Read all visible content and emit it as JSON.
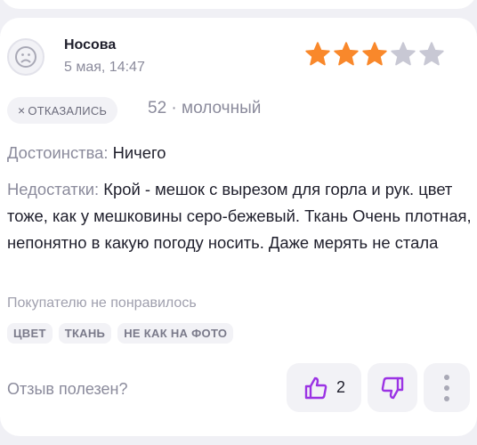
{
  "review": {
    "author": "Носова",
    "date": "5 мая, 14:47",
    "rating": 3,
    "max_rating": 5,
    "status_chip": "ОТКАЗАЛИСЬ",
    "status_icon": "close-icon",
    "variant": "52 · молочный",
    "pros_label": "Достоинства:",
    "pros_text": "Ничего",
    "cons_label": "Недостатки:",
    "cons_text": "Крой - мешок с вырезом для горла и рук. цвет тоже, как у мешковины серо-бежевый. Ткань Очень плотная, непонятно в какую погоду носить. Даже мерять не стала",
    "dislike_title": "Покупателю не понравилось",
    "dislike_tags": [
      "ЦВЕТ",
      "ТКАНЬ",
      "НЕ КАК НА ФОТО"
    ],
    "helpful_label": "Отзыв полезен?",
    "like_count": "2"
  },
  "colors": {
    "star_filled": "#f9882b",
    "star_empty": "#c8c8d4",
    "accent": "#9b33e4",
    "background": "#f0f0f5",
    "card": "#ffffff"
  },
  "icons": {
    "avatar": "sad-face-icon",
    "like": "thumbs-up-icon",
    "dislike": "thumbs-down-icon",
    "more": "more-vertical-icon"
  }
}
